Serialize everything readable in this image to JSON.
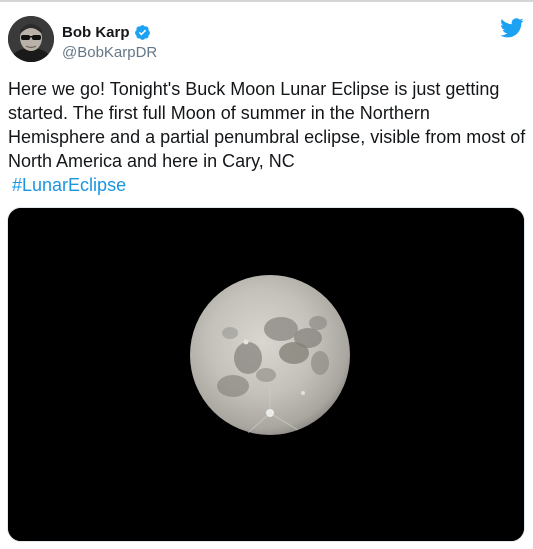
{
  "author": {
    "display_name": "Bob Karp",
    "handle": "@BobKarpDR",
    "verified": true,
    "avatar_icon": "person-with-sunglasses-avatar"
  },
  "platform": {
    "icon": "twitter-bird-icon",
    "color": "#1da1f2"
  },
  "tweet": {
    "text": "Here we go! Tonight's Buck Moon Lunar Eclipse is just getting started. The first full Moon of summer in the Northern Hemisphere and a partial penumbral eclipse, visible from most of North America and here in Cary, NC",
    "hashtag": "#LunarEclipse"
  },
  "media": {
    "type": "photo",
    "subject": "full-moon-photo",
    "background_color": "#000000"
  },
  "colors": {
    "link": "#1b95e0",
    "verified_badge": "#1da1f2",
    "handle_gray": "#657786"
  }
}
